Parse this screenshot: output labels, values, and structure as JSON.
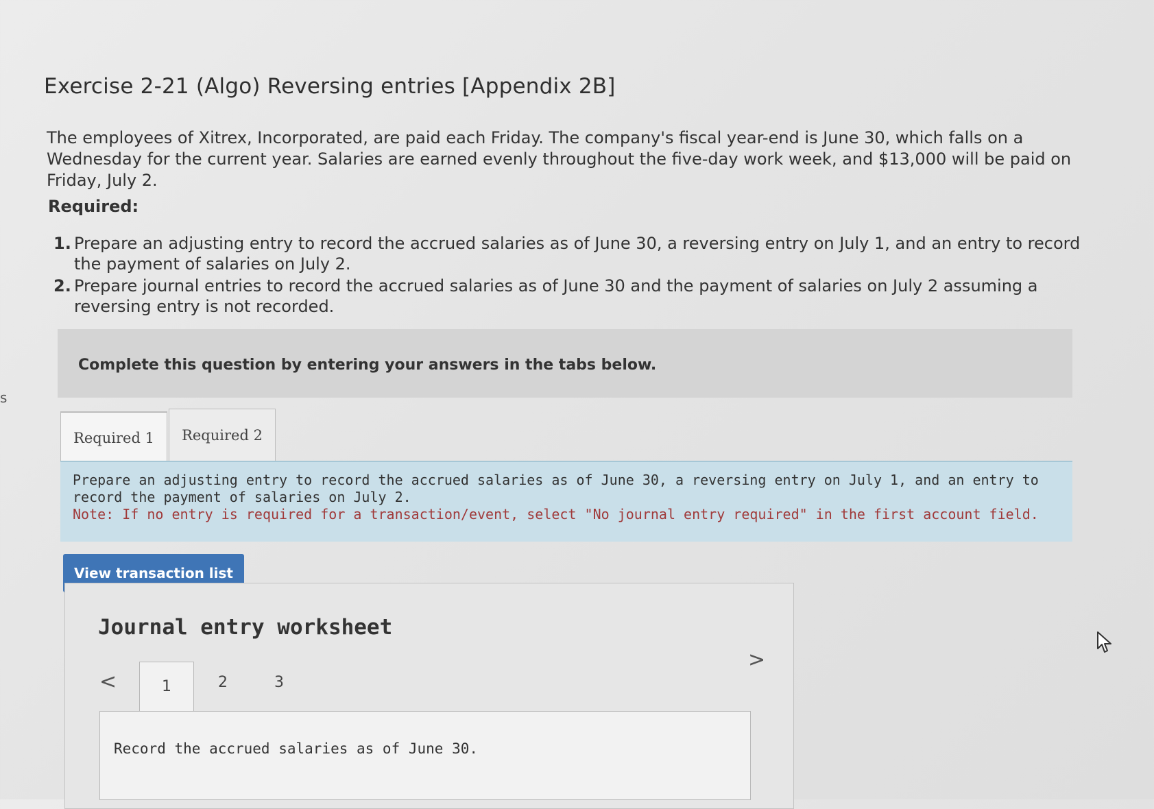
{
  "page": {
    "edge_letter": "s",
    "title": "Exercise 2-21 (Algo) Reversing entries [Appendix 2B]",
    "intro": "The employees of Xitrex, Incorporated, are paid each Friday. The company's fiscal year-end is June 30, which falls on a Wednesday for the current year. Salaries are earned evenly throughout the five-day work week, and $13,000 will be paid on Friday, July 2.",
    "required_heading": "Required:",
    "requirements": [
      {
        "num": "1.",
        "text": "Prepare an adjusting entry to record the accrued salaries as of June 30, a reversing entry on July 1, and an entry to record the payment of salaries on July 2."
      },
      {
        "num": "2.",
        "text": "Prepare journal entries to record the accrued salaries as of June 30 and the payment of salaries on July 2 assuming a reversing entry is not recorded."
      }
    ]
  },
  "question": {
    "instruction": "Complete this question by entering your answers in the tabs below.",
    "tabs": [
      {
        "label": "Required 1",
        "active": true
      },
      {
        "label": "Required 2",
        "active": false
      }
    ],
    "prompt": "Prepare an adjusting entry to record the accrued salaries as of June 30, a reversing entry on July 1, and an entry to record the payment of salaries on July 2.",
    "note": "Note: If no entry is required for a transaction/event, select \"No journal entry required\" in the first account field.",
    "view_button": "View transaction list"
  },
  "worksheet": {
    "title": "Journal entry worksheet",
    "prev": "<",
    "next": ">",
    "pages": [
      "1",
      "2",
      "3"
    ],
    "active_page": "1",
    "record_text": "Record the accrued salaries as of June 30."
  },
  "icons": {
    "cursor": "mouse-pointer-icon"
  },
  "colors": {
    "button_bg": "#3f75b6",
    "prompt_bg": "#c9dfe9",
    "note_text": "#a03a3a"
  }
}
